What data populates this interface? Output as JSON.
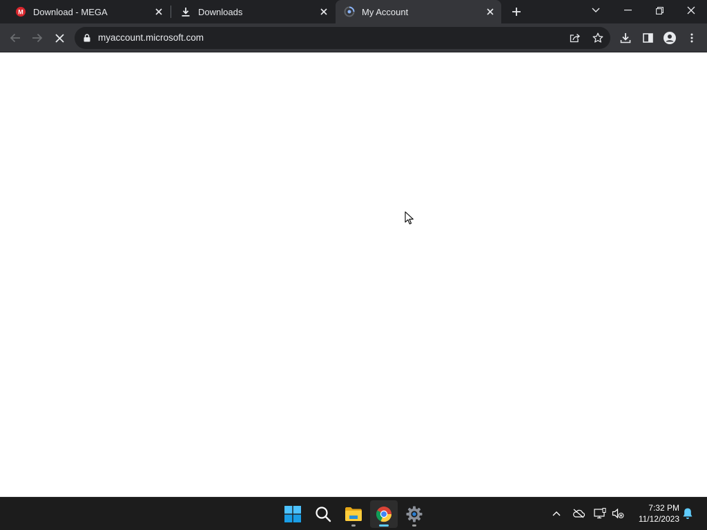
{
  "browser": {
    "tabs": [
      {
        "title": "Download - MEGA",
        "icon": "mega-icon",
        "active": false
      },
      {
        "title": "Downloads",
        "icon": "download-icon",
        "active": false
      },
      {
        "title": "My Account",
        "icon": "loading-globe-icon",
        "active": true
      }
    ],
    "address_bar": {
      "url": "myaccount.microsoft.com"
    }
  },
  "taskbar": {
    "apps": [
      "start-icon",
      "search-icon",
      "file-explorer-icon",
      "chrome-icon",
      "settings-icon"
    ],
    "clock": {
      "time": "7:32 PM",
      "date": "11/12/2023"
    }
  },
  "colors": {
    "titlebar": "#202124",
    "toolbar": "#35363a",
    "taskbar": "#1c1c1c",
    "accent": "#60cdff"
  }
}
